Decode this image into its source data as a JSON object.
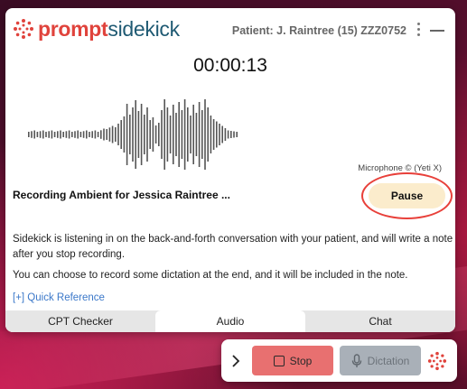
{
  "app": {
    "logo_prompt": "prompt",
    "logo_sidekick": "sidekick",
    "brand_red": "#e0433c",
    "brand_teal": "#1f5a73"
  },
  "header": {
    "patient": "Patient: J. Raintree (15) ZZZ0752"
  },
  "recorder": {
    "timer": "00:00:13",
    "microphone": "Microphone © (Yeti X)",
    "title": "Recording Ambient for  Jessica Raintree ...",
    "pause_label": "Pause",
    "info_line1": "Sidekick is listening in on the back-and-forth conversation with your patient, and will write a note after you stop recording.",
    "info_line2": "You can choose to record some dictation at the end, and it will be included in the note.",
    "quick_reference": "[+] Quick Reference"
  },
  "tabs": [
    {
      "label": "CPT Checker",
      "active": false
    },
    {
      "label": "Audio",
      "active": true
    },
    {
      "label": "Chat",
      "active": false
    }
  ],
  "controls": {
    "stop_label": "Stop",
    "dictation_label": "Dictation",
    "stop_color": "#e87070",
    "dictation_color": "#a9b0b8"
  },
  "icons": [
    "prompt-logo-icon",
    "more-vertical-icon",
    "minimize-icon",
    "chevron-right-icon",
    "stop-square-icon",
    "microphone-icon",
    "sidekick-bubble-icon"
  ]
}
